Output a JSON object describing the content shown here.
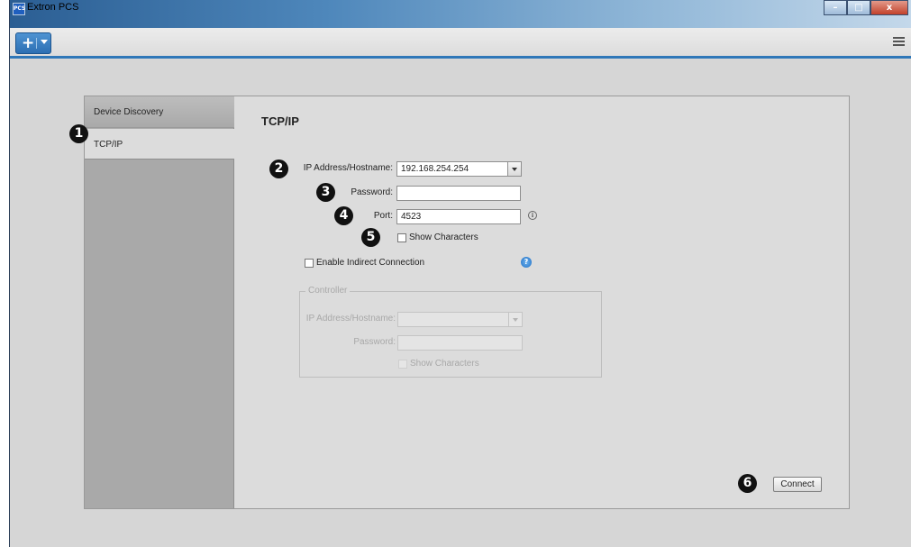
{
  "window": {
    "title": "Extron PCS",
    "app_icon_text": "PCS",
    "minimize": "–",
    "maximize": "□",
    "close": "x"
  },
  "toolbar": {
    "new_label": "+"
  },
  "sidebar": {
    "items": [
      {
        "label": "Device Discovery"
      },
      {
        "label": "TCP/IP"
      }
    ]
  },
  "main": {
    "heading": "TCP/IP",
    "ip_label": "IP Address/Hostname:",
    "ip_value": "192.168.254.254",
    "password_label": "Password:",
    "password_value": "",
    "port_label": "Port:",
    "port_value": "4523",
    "show_characters_label": "Show Characters",
    "show_characters_checked": false,
    "indirect_label": "Enable Indirect Connection",
    "indirect_checked": false,
    "info_symbol": "i",
    "help_symbol": "?"
  },
  "controller": {
    "title": "Controller",
    "ip_label": "IP Address/Hostname:",
    "password_label": "Password:",
    "show_characters_label": "Show Characters"
  },
  "connect_label": "Connect",
  "callouts": [
    "1",
    "2",
    "3",
    "4",
    "5",
    "6"
  ]
}
